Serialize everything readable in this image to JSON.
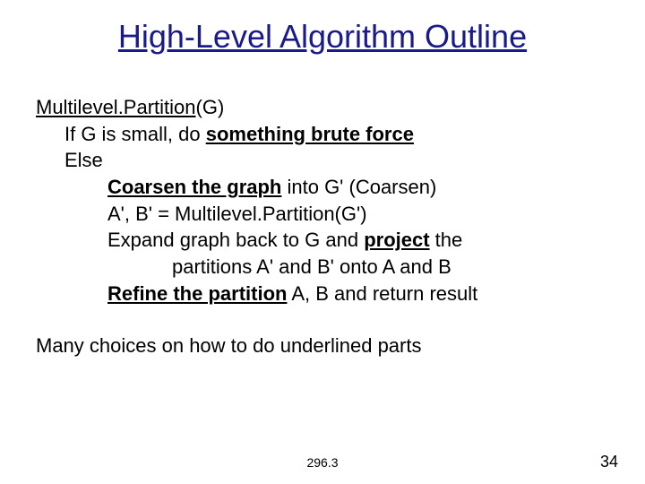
{
  "title": "High-Level Algorithm Outline",
  "algo": {
    "fn_name": "Multilevel.Partition",
    "fn_arg_open": "(",
    "fn_arg": "G",
    "fn_arg_close": ")",
    "if_prefix": "If G is small, do ",
    "if_bold": "something brute force",
    "else_text": "Else",
    "coarsen_bold": "Coarsen the graph",
    "coarsen_rest": " into G' (Coarsen)",
    "recurse": "A', B' = Multilevel.Partition(G')",
    "expand_prefix": "Expand graph back to G and ",
    "project_bold": "project",
    "expand_suffix": " the",
    "expand_line2": "partitions A' and B' onto A and B",
    "refine_bold": "Refine the partition",
    "refine_rest": " A, B and return result"
  },
  "closing": "Many choices on how to do underlined parts",
  "footer": "296.3",
  "slide_number": "34"
}
